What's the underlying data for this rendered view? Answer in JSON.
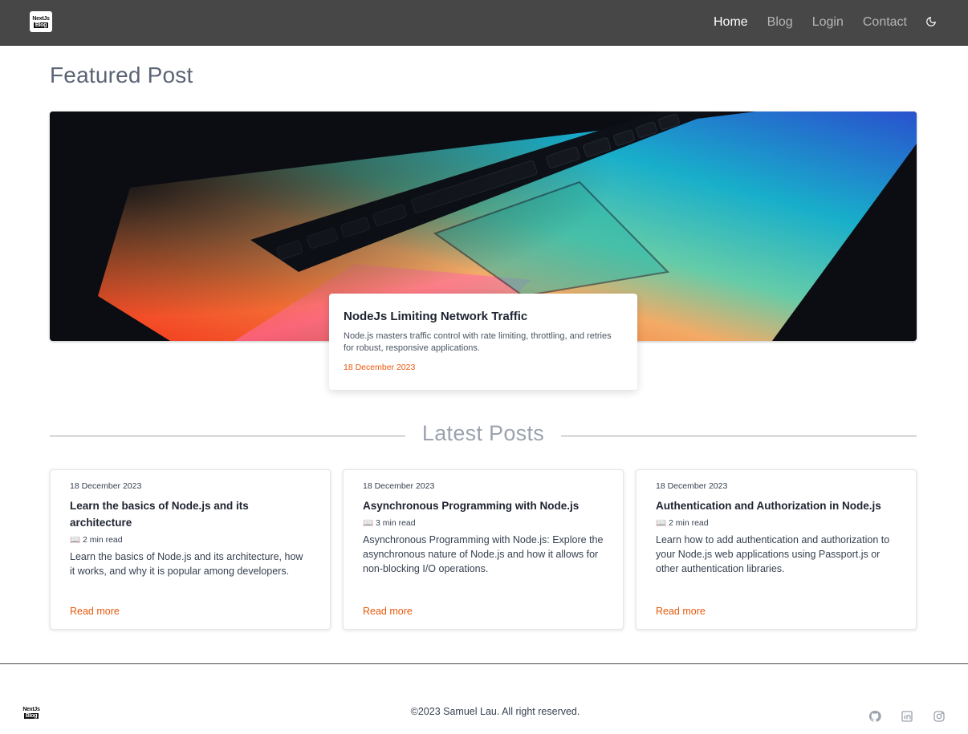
{
  "nav": {
    "logo_line1": "NextJs",
    "logo_line2": "Blog",
    "links": [
      "Home",
      "Blog",
      "Login",
      "Contact"
    ]
  },
  "featured": {
    "heading": "Featured Post",
    "title": "NodeJs Limiting Network Traffic",
    "description": "Node.js masters traffic control with rate limiting, throttling, and retries for robust, responsive applications.",
    "date": "18 December 2023"
  },
  "latest": {
    "heading": "Latest Posts",
    "posts": [
      {
        "date": "18 December 2023",
        "title": "Learn the basics of Node.js and its architecture",
        "read_time": "📖 2 min read",
        "description": "Learn the basics of Node.js and its architecture, how it works, and why it is popular among developers.",
        "link": "Read more"
      },
      {
        "date": "18 December 2023",
        "title": "Asynchronous Programming with Node.js",
        "read_time": "📖 3 min read",
        "description": "Asynchronous Programming with Node.js: Explore the asynchronous nature of Node.js and how it allows for non-blocking I/O operations.",
        "link": "Read more"
      },
      {
        "date": "18 December 2023",
        "title": "Authentication and Authorization in Node.js",
        "read_time": "📖 2 min read",
        "description": "Learn how to add authentication and authorization to your Node.js web applications using Passport.js or other authentication libraries.",
        "link": "Read more"
      }
    ]
  },
  "footer": {
    "copyright": "©2023 Samuel Lau. All right reserved.",
    "social_icons": [
      "github-icon",
      "linkedin-icon",
      "instagram-icon"
    ]
  },
  "colors": {
    "accent": "#ea580c",
    "navbar": "#474747"
  }
}
